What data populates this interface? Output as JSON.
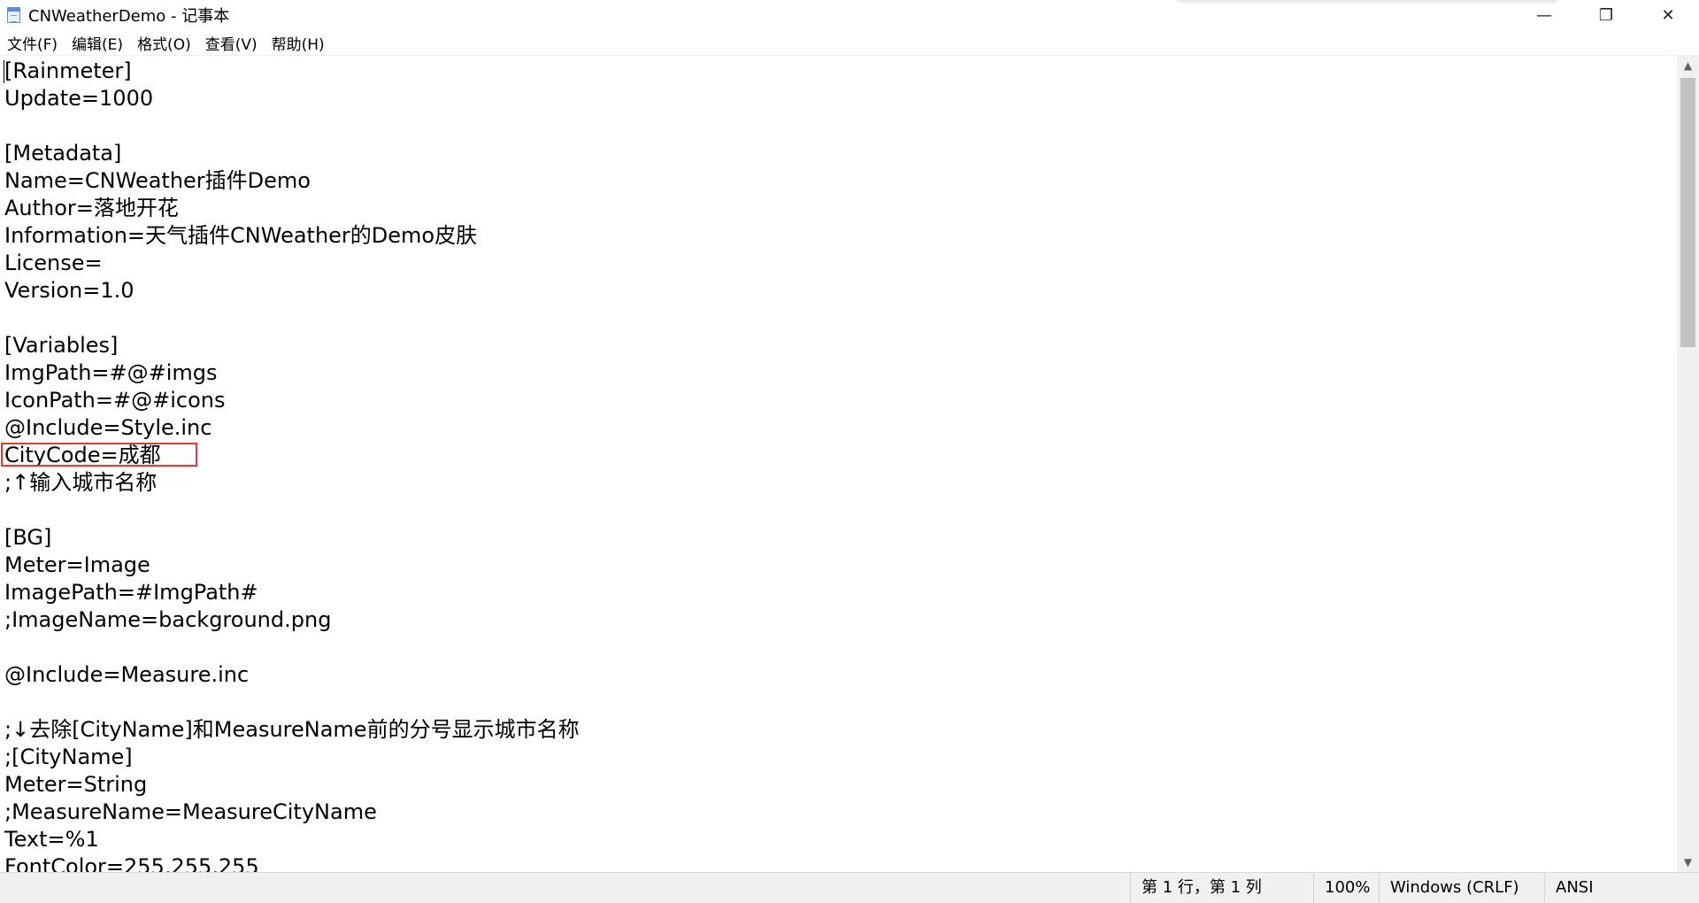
{
  "window": {
    "title": "CNWeatherDemo - 记事本"
  },
  "title_controls": {
    "minimize_glyph": "—",
    "restore_glyph": "❐",
    "close_glyph": "✕"
  },
  "menu": [
    {
      "label": "文件(F)"
    },
    {
      "label": "编辑(E)"
    },
    {
      "label": "格式(O)"
    },
    {
      "label": "查看(V)"
    },
    {
      "label": "帮助(H)"
    }
  ],
  "editor": {
    "lines": [
      "[Rainmeter]",
      "Update=1000",
      "",
      "[Metadata]",
      "Name=CNWeather插件Demo",
      "Author=落地开花",
      "Information=天气插件CNWeather的Demo皮肤",
      "License=",
      "Version=1.0",
      "",
      "[Variables]",
      "ImgPath=#@#imgs",
      "IconPath=#@#icons",
      "@Include=Style.inc",
      "CityCode=成都",
      ";↑输入城市名称",
      "",
      "[BG]",
      "Meter=Image",
      "ImagePath=#ImgPath#",
      ";ImageName=background.png",
      "",
      "@Include=Measure.inc",
      "",
      ";↓去除[CityName]和MeasureName前的分号显示城市名称",
      ";[CityName]",
      "Meter=String",
      ";MeasureName=MeasureCityName",
      "Text=%1",
      "FontColor=255,255,255"
    ],
    "highlight_color": "#e23a3a"
  },
  "scrollbar": {
    "up_glyph": "▲",
    "down_glyph": "▼"
  },
  "statusbar": {
    "position": "第 1 行，第 1 列",
    "zoom": "100%",
    "line_ending": "Windows (CRLF)",
    "encoding": "ANSI"
  }
}
